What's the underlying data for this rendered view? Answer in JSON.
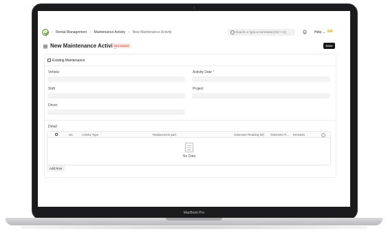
{
  "navbar": {
    "breadcrumbs": [
      "Rental Management",
      "Maintenance Activity",
      "New Maintenance Activity"
    ],
    "search_placeholder": "Search or type a command (Ctrl + G)",
    "help_label": "Help",
    "avatar_initials": "EM"
  },
  "page": {
    "title": "New Maintenance Activity",
    "status_badge": "Not Saved",
    "save_label": "Save"
  },
  "form": {
    "existing_maintenance_label": "Existing Maintenance",
    "vehicle_label": "Vehicle",
    "activity_date_label": "Activity Date",
    "activity_date_required": "*",
    "shift_label": "Shift",
    "project_label": "Project",
    "driver_label": "Driver",
    "detail_label": "Detail"
  },
  "detail_table": {
    "columns": [
      "No.",
      "Activity Type",
      "Replacement part",
      "Odometer Reading (M)",
      "Odometer R...",
      "Remarks"
    ],
    "empty_text": "No Data",
    "add_row_label": "Add Row"
  },
  "device": {
    "model_label": "MacBook Pro"
  },
  "colors": {
    "save_button": "#171717",
    "badge_text": "#c0392b",
    "badge_bg": "#fde4e1",
    "avatar": "#e2a800"
  }
}
